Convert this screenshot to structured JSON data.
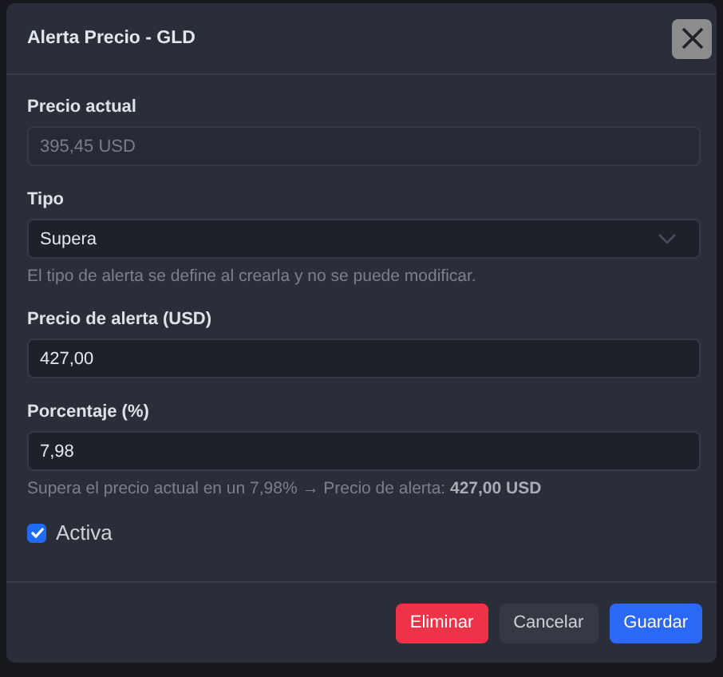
{
  "dialog": {
    "title": "Alerta Precio - GLD",
    "fields": [
      {
        "kind": "text",
        "label": "Precio actual",
        "value": "395,45 USD",
        "disabled": true
      },
      {
        "kind": "select",
        "label": "Tipo",
        "value": "Supera",
        "disabled": false,
        "help": "El tipo de alerta se define al crearla y no se puede modificar."
      },
      {
        "kind": "text",
        "label": "Precio de alerta (USD)",
        "value": "427,00",
        "disabled": false
      },
      {
        "kind": "text",
        "label": "Porcentaje (%)",
        "value": "7,98",
        "disabled": false,
        "help": "Supera el precio actual en un 7,98% → Precio de alerta: **427,00 USD**"
      }
    ],
    "checkbox": {
      "label": "Activa",
      "checked": true
    },
    "buttons": [
      {
        "label": "Eliminar",
        "kind": "danger"
      },
      {
        "label": "Cancelar",
        "kind": "secondary"
      },
      {
        "label": "Guardar",
        "kind": "primary"
      }
    ]
  }
}
